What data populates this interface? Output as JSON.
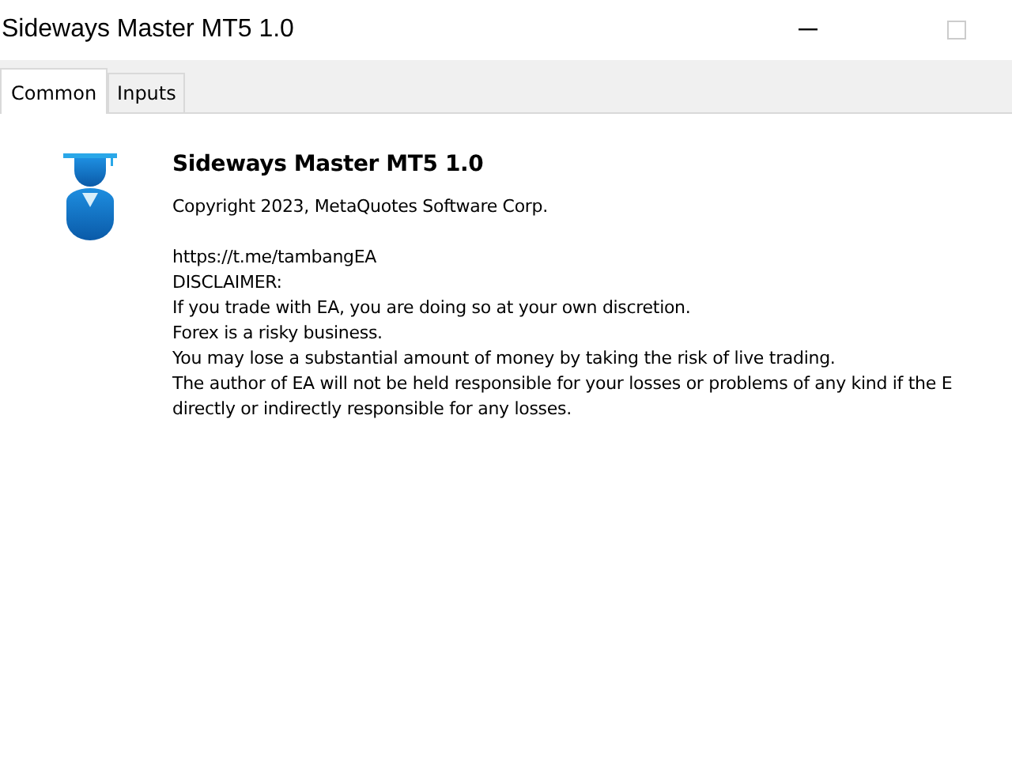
{
  "window": {
    "title": "Sideways Master MT5 1.0"
  },
  "tabs": [
    {
      "label": "Common",
      "selected": true
    },
    {
      "label": "Inputs",
      "selected": false
    }
  ],
  "info": {
    "name": "Sideways Master MT5 1.0",
    "copyright": "Copyright 2023, MetaQuotes Software Corp.",
    "description": [
      "https://t.me/tambangEA",
      "DISCLAIMER:",
      "If you trade with EA, you are doing so at your own discretion.",
      "Forex is a risky business.",
      "You may lose a substantial amount of money by taking the risk of live trading.",
      "The author of EA will not be held responsible for your losses or problems of any kind if the E",
      "directly or indirectly responsible for any losses."
    ]
  }
}
